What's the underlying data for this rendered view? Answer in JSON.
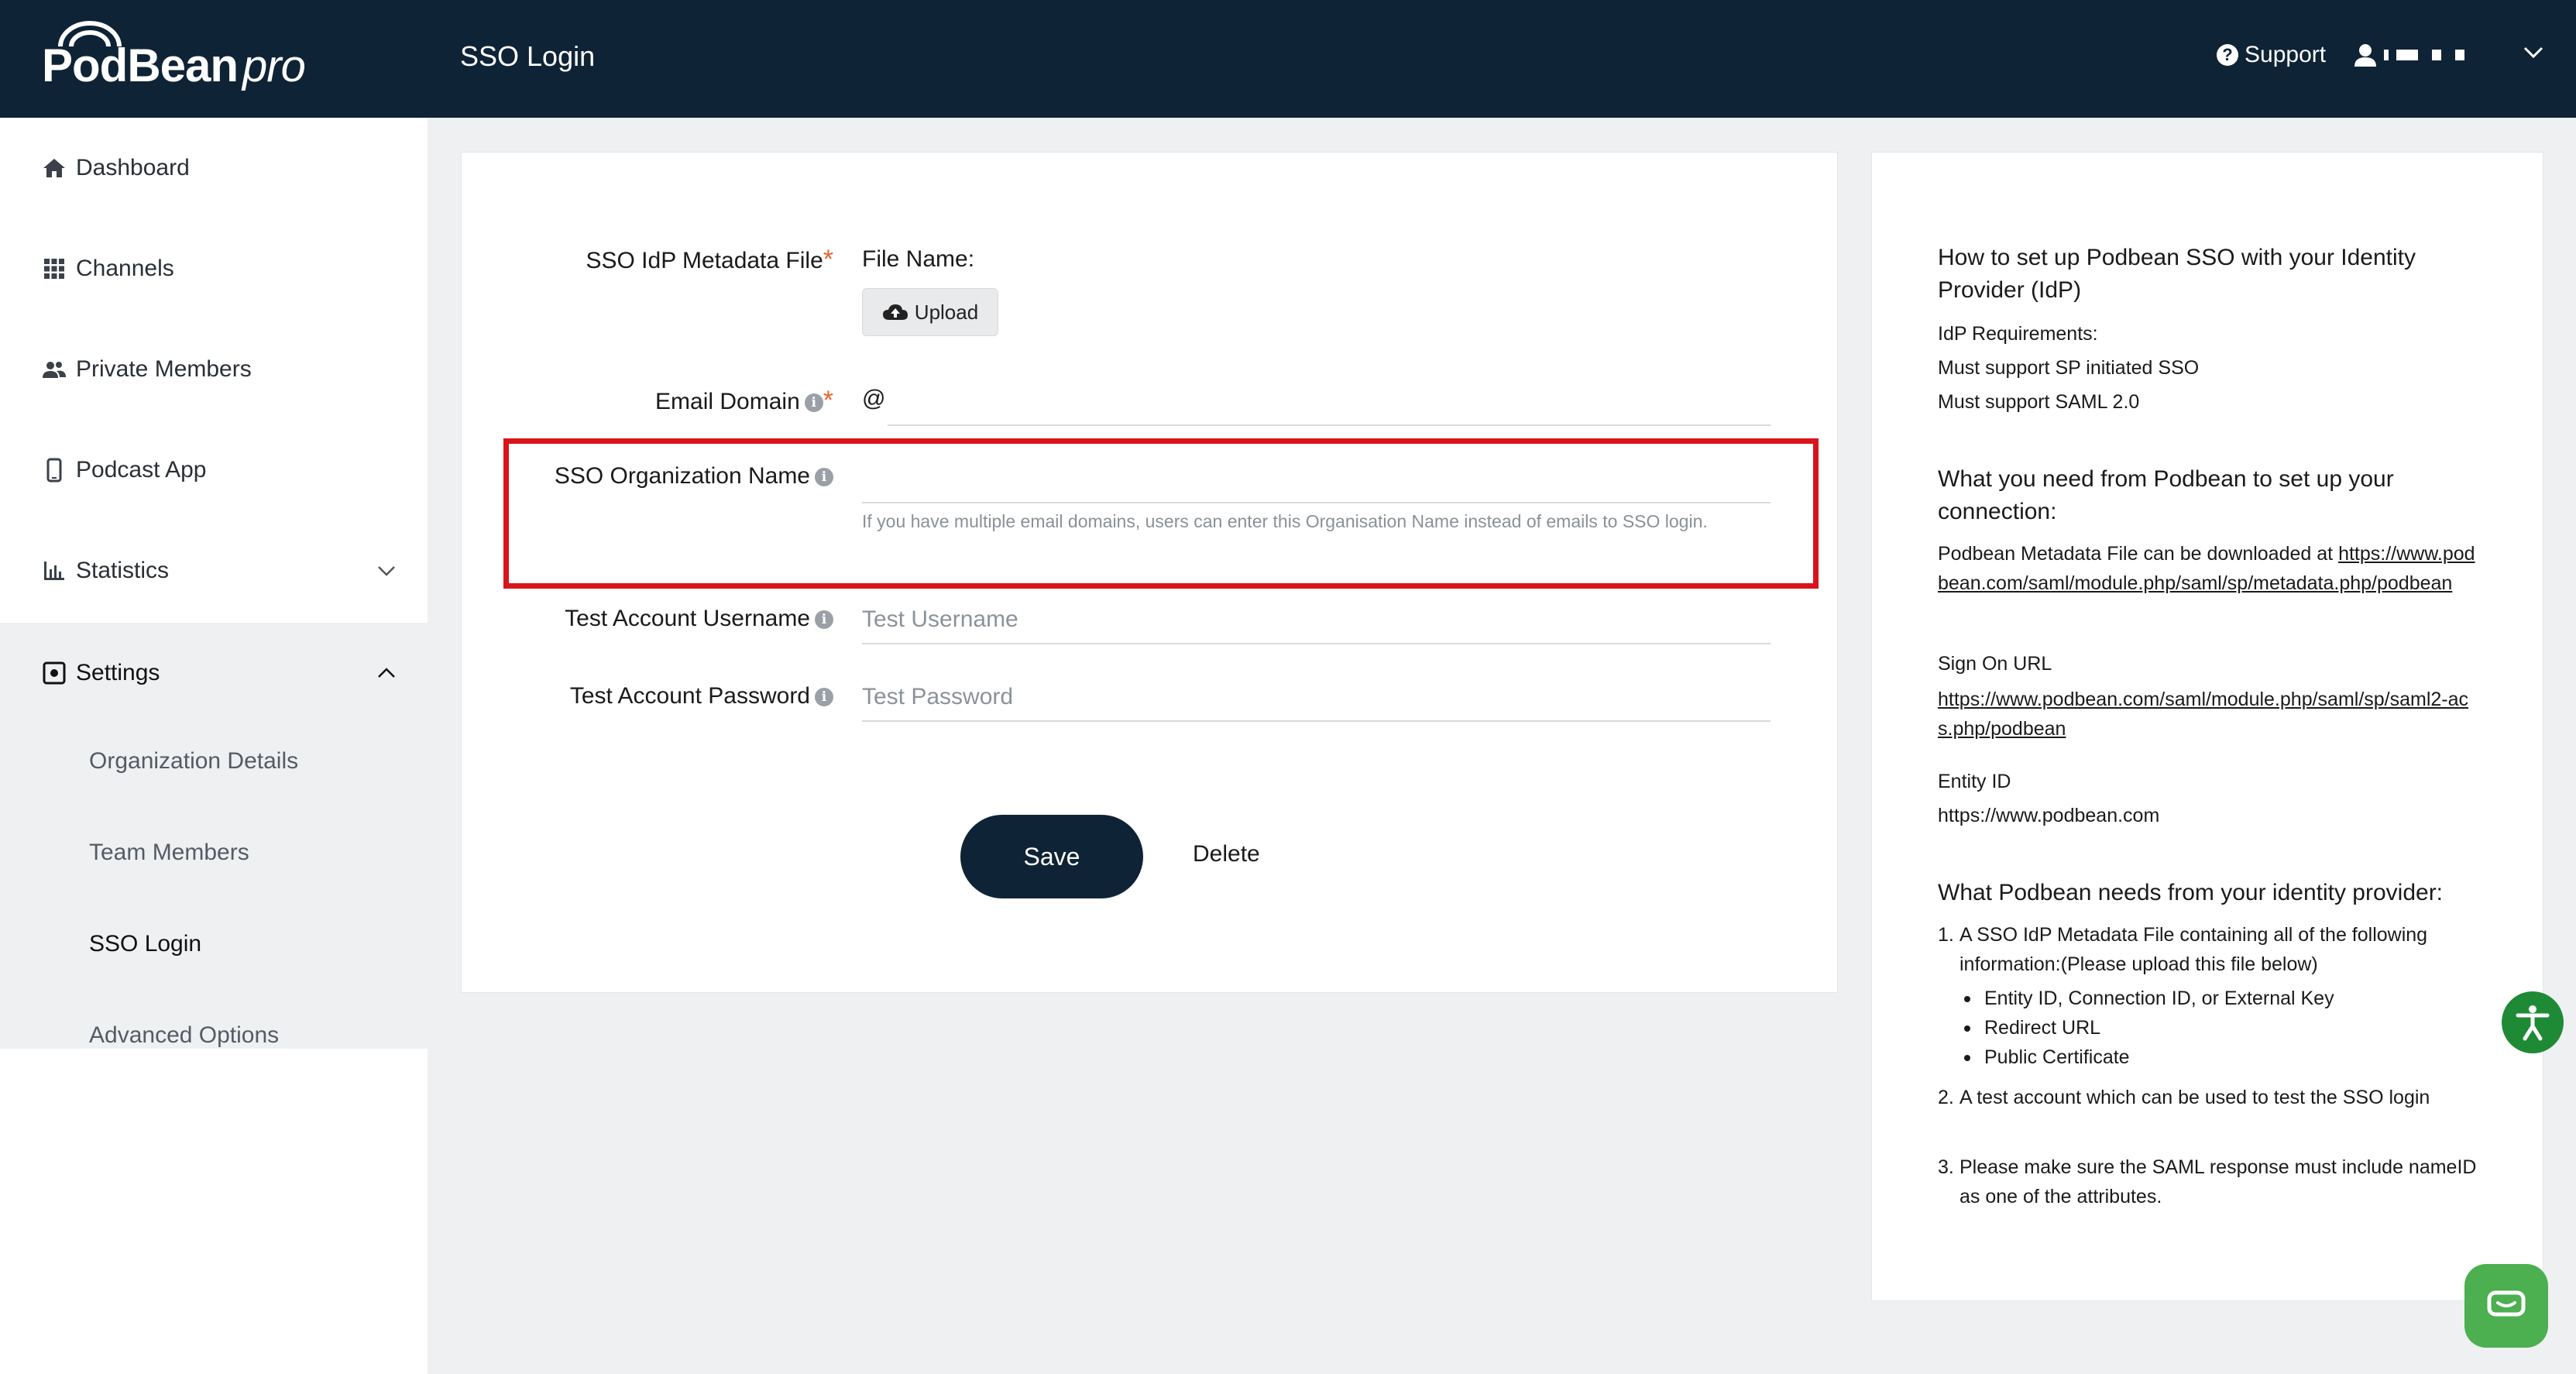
{
  "header": {
    "logo_text": "PodBean",
    "logo_pro": "pro",
    "page_title": "SSO Login",
    "support_label": "Support",
    "support_icon": "question-circle-icon",
    "user_icon": "user-icon"
  },
  "sidebar": {
    "items": [
      {
        "label": "Dashboard",
        "icon": "home-icon"
      },
      {
        "label": "Channels",
        "icon": "grid-icon"
      },
      {
        "label": "Private Members",
        "icon": "users-icon"
      },
      {
        "label": "Podcast App",
        "icon": "phone-icon"
      },
      {
        "label": "Statistics",
        "icon": "bar-chart-icon"
      },
      {
        "label": "Settings",
        "icon": "settings-icon"
      }
    ],
    "settings_sub": [
      {
        "label": "Organization Details"
      },
      {
        "label": "Team Members"
      },
      {
        "label": "SSO Login",
        "active": true
      },
      {
        "label": "Advanced Options"
      }
    ]
  },
  "form": {
    "metadata_label": "SSO IdP Metadata File",
    "file_name_label": "File Name:",
    "upload_label": "Upload",
    "email_domain_label": "Email Domain",
    "email_prefix": "@",
    "email_domain_value": "",
    "org_name_label": "SSO Organization Name",
    "org_name_value": "",
    "org_name_hint": "If you have multiple email domains, users can enter this Organisation Name instead of emails to SSO login.",
    "test_username_label": "Test Account Username",
    "test_username_placeholder": "Test Username",
    "test_password_label": "Test Account Password",
    "test_password_placeholder": "Test Password",
    "required_mark": "*",
    "save_label": "Save",
    "delete_label": "Delete"
  },
  "help": {
    "title": "How to set up Podbean SSO with your Identity Provider (IdP)",
    "req_heading": "IdP Requirements:",
    "req_1": "Must support SP initiated SSO",
    "req_2": "Must support SAML 2.0",
    "need_title": "What you need from Podbean to set up your connection:",
    "metadata_text": "Podbean Metadata File can be downloaded at",
    "metadata_url": "https://www.podbean.com/saml/module.php/saml/sp/metadata.php/podbean",
    "signon_label": "Sign On URL",
    "signon_url": "https://www.podbean.com/saml/module.php/saml/sp/saml2-acs.php/podbean",
    "entity_label": "Entity ID",
    "entity_value": "https://www.podbean.com",
    "provider_title": "What Podbean needs from your identity provider:",
    "step_1": "A SSO IdP Metadata File containing all of the following information:(Please upload this file below)",
    "bullet_1": "Entity ID, Connection ID, or External Key",
    "bullet_2": "Redirect URL",
    "bullet_3": "Public Certificate",
    "step_2": "A test account which can be used to test the SSO login",
    "step_3": "Please make sure the SAML response must include nameID as one of the attributes.",
    "num_1": "1.",
    "num_2": "2.",
    "num_3": "3."
  },
  "widgets": {
    "accessibility_icon": "accessibility-icon",
    "chat_icon": "chat-icon"
  }
}
